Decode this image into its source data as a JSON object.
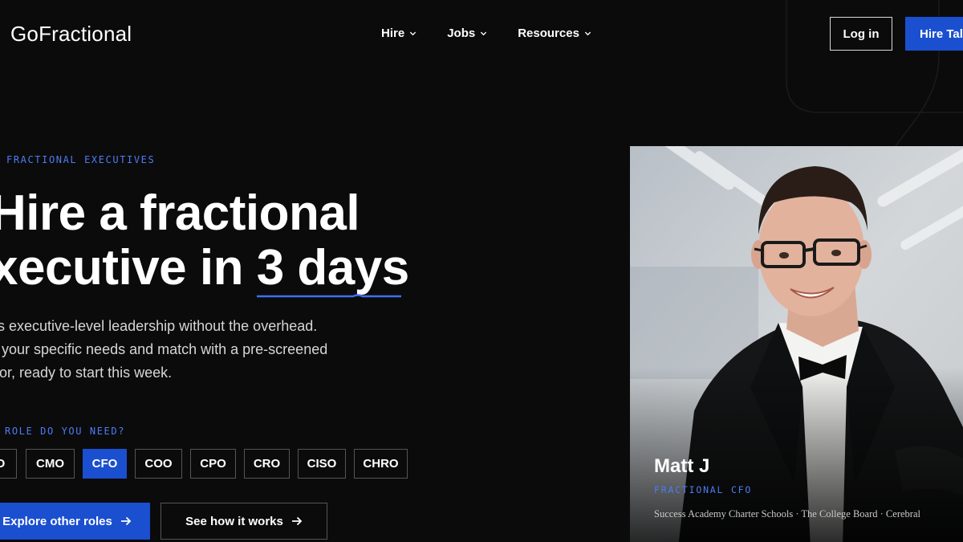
{
  "header": {
    "logo": "GoFractional",
    "nav": [
      {
        "label": "Hire"
      },
      {
        "label": "Jobs"
      },
      {
        "label": "Resources"
      }
    ],
    "login_label": "Log in",
    "hire_label": "Hire Tale"
  },
  "hero": {
    "eyebrow": "FRACTIONAL EXECUTIVES",
    "headline_line1": "Hire a fractional",
    "headline_line2_prefix": "xecutive in ",
    "headline_highlight": "3 days",
    "sub_lines": [
      "ess executive-level leadership without the overhead.",
      "us your specific needs and match with a pre-screened",
      "rator, ready to start this week."
    ],
    "role_question": "ROLE DO YOU NEED?",
    "roles": [
      {
        "label": "O",
        "active": false
      },
      {
        "label": "CMO",
        "active": false
      },
      {
        "label": "CFO",
        "active": true
      },
      {
        "label": "COO",
        "active": false
      },
      {
        "label": "CPO",
        "active": false
      },
      {
        "label": "CRO",
        "active": false
      },
      {
        "label": "CISO",
        "active": false
      },
      {
        "label": "CHRO",
        "active": false
      }
    ],
    "cta_primary": "Explore other roles",
    "cta_secondary": "See how it works"
  },
  "profile": {
    "name": "Matt J",
    "role": "FRACTIONAL CFO",
    "companies": "Success Academy Charter Schools · The College Board · Cerebral"
  },
  "colors": {
    "background": "#0b0b0c",
    "accent": "#1a4fd0",
    "eyebrow": "#4d7cf2",
    "highlight_underline": "#3d6ff0"
  }
}
